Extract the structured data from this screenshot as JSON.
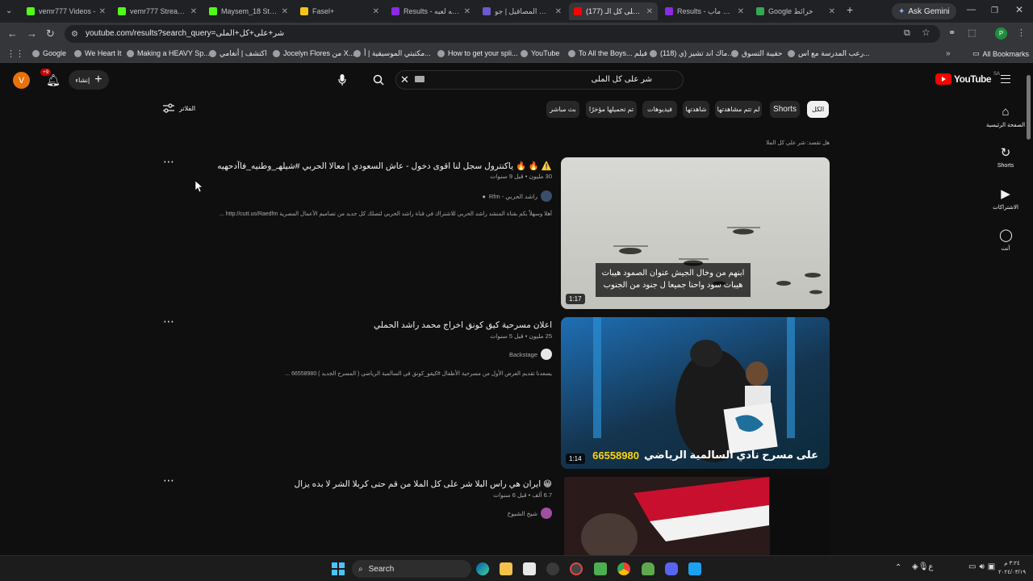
{
  "browser": {
    "tabs": [
      {
        "title": "vemr777 Videos - ",
        "favicon": "kick-icon",
        "color": "#53fc18"
      },
      {
        "title": "vemr777 Stream - ",
        "favicon": "kick-icon",
        "color": "#53fc18"
      },
      {
        "title": "Maysem_18 Stream",
        "favicon": "kick-icon",
        "color": "#53fc18"
      },
      {
        "title": "Fasel+",
        "favicon": "bulb-icon",
        "color": "#f5c518"
      },
      {
        "title": "Results - جوله لعبه",
        "favicon": "w-icon",
        "color": "#8a2be2"
      },
      {
        "title": "حرب المصاقيل | جو",
        "favicon": "play-icon",
        "color": "#6a5acd"
      },
      {
        "title": "(177) شر على كل الـ",
        "favicon": "youtube-icon",
        "color": "#ff0000"
      },
      {
        "title": "Results - فوقل ماب",
        "favicon": "w-icon",
        "color": "#8a2be2"
      },
      {
        "title": "Google خرائط",
        "favicon": "maps-icon",
        "color": "#34a853"
      }
    ],
    "ask_gemini": "Ask Gemini",
    "url": "youtube.com/results?search_query=شر+على+كل+الملى",
    "bookmarks": [
      "Google",
      "We Heart It",
      "Making a HEAVY Sp...",
      "اكتشف | أنغامي",
      "Jocelyn Flores من X...",
      "مكتبتي الموسيقية | أ...",
      "How to get your spli...",
      "YouTube",
      "To All the Boys... فيلم",
      "(118) ماك اند تشيز (ي...",
      "حقيبة التسوق",
      "رعب المدرسة مع اس..."
    ],
    "all_bookmarks": "All Bookmarks"
  },
  "youtube": {
    "logo_text": "YouTube",
    "logo_region": "SA",
    "search_query": "شر على كل الملى",
    "create_label": "إنشاء",
    "notif_count": "+9",
    "avatar_letter": "V",
    "filters_label": "الفلاتر",
    "chips": [
      "الكل",
      "Shorts",
      "لم تتم مشاهدتها",
      "شاهدتها",
      "فيديوهات",
      "تم تحميلها مؤخرًا",
      "بث مباشر"
    ],
    "suggestion": "هل تقصد: شر على كل الملا",
    "sidenav": [
      {
        "label": "الصفحة الرئيسية",
        "icon": "home-icon"
      },
      {
        "label": "Shorts",
        "icon": "shorts-icon"
      },
      {
        "label": "الاشتراكات",
        "icon": "subscriptions-icon"
      },
      {
        "label": "أنت",
        "icon": "you-icon"
      }
    ],
    "results": [
      {
        "title": "⚠️ 🔥 🔥 ياكنترول سجل لنا اقوى دخول - عاش السعودي | معالا الحربي #شيلهـ_وطنيه_فاآدحهيه",
        "meta": "30 مليون • قبل 9 سنوات",
        "channel": "راشد الحربي - Rfm",
        "description": "أهلا وسهلاً بكم بقناة المنشد راشد الحربي للاشتراك في قناة راشد الحربي لتصلك كل جديد من تصاميم الأعمال المصرية http://cutt.us/Raedfm ...",
        "duration": "1:17",
        "caption_line1": "ابنهم من وخال الجيش عنوان الصمود هيبات",
        "caption_line2": "هيبات سود واحنا جميعا ل جنود من الجنوب"
      },
      {
        "title": "اعلان مسرحية كيق كونق اخراج محمد راشد الحملي",
        "meta": "25 مليون • قبل 5 سنوات",
        "channel": "Backstage",
        "description": "يسعدنا تقديم العرض الأول من مسرحية الأطفال #كيقو_كونق في السالمية الرياضي ( المسرح الجديد ) 66558980 ...",
        "duration": "1:14",
        "banner_text": "على مسرح نادي السالمية الرياضي",
        "banner_number": "66558980"
      },
      {
        "title": "😁 ايران هي راس البلا شر على كل الملا من قم حتى كربلا الشر لا بده يزال",
        "meta": "6.7 ألف • قبل 6 سنوات",
        "channel": "شيخ الشيوخ",
        "description": ""
      }
    ]
  },
  "taskbar": {
    "search_label": "Search",
    "time": "٣:٢٤ م",
    "date": "٢٠٢٤/٠٣/١٩"
  }
}
